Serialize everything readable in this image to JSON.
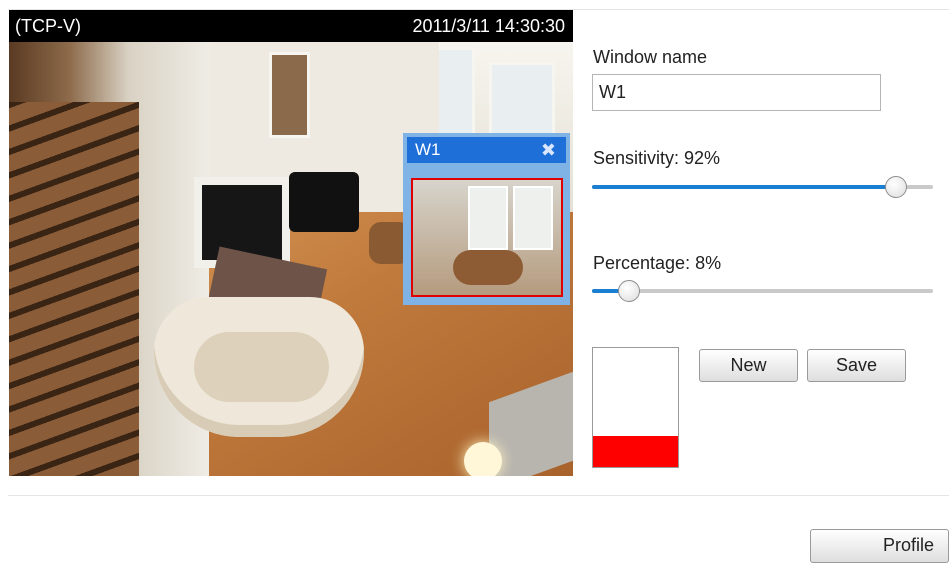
{
  "viewer": {
    "stream_label": "(TCP-V)",
    "timestamp": "2011/3/11 14:30:30"
  },
  "motion_window": {
    "title": "W1",
    "close_icon": "close-icon",
    "border_color": "#e00000",
    "header_color": "#1f6fd8"
  },
  "panel": {
    "window_name_label": "Window name",
    "window_name_value": "W1",
    "sensitivity_label": "Sensitivity: 92%",
    "sensitivity_value": 92,
    "percentage_label": "Percentage: 8%",
    "percentage_value": 8,
    "activity_level": 0.26,
    "new_button": "New",
    "save_button": "Save"
  },
  "footer": {
    "profile_button": "Profile"
  },
  "colors": {
    "slider_fill": "#1a7fd0",
    "activity_bar": "#ff0000"
  }
}
